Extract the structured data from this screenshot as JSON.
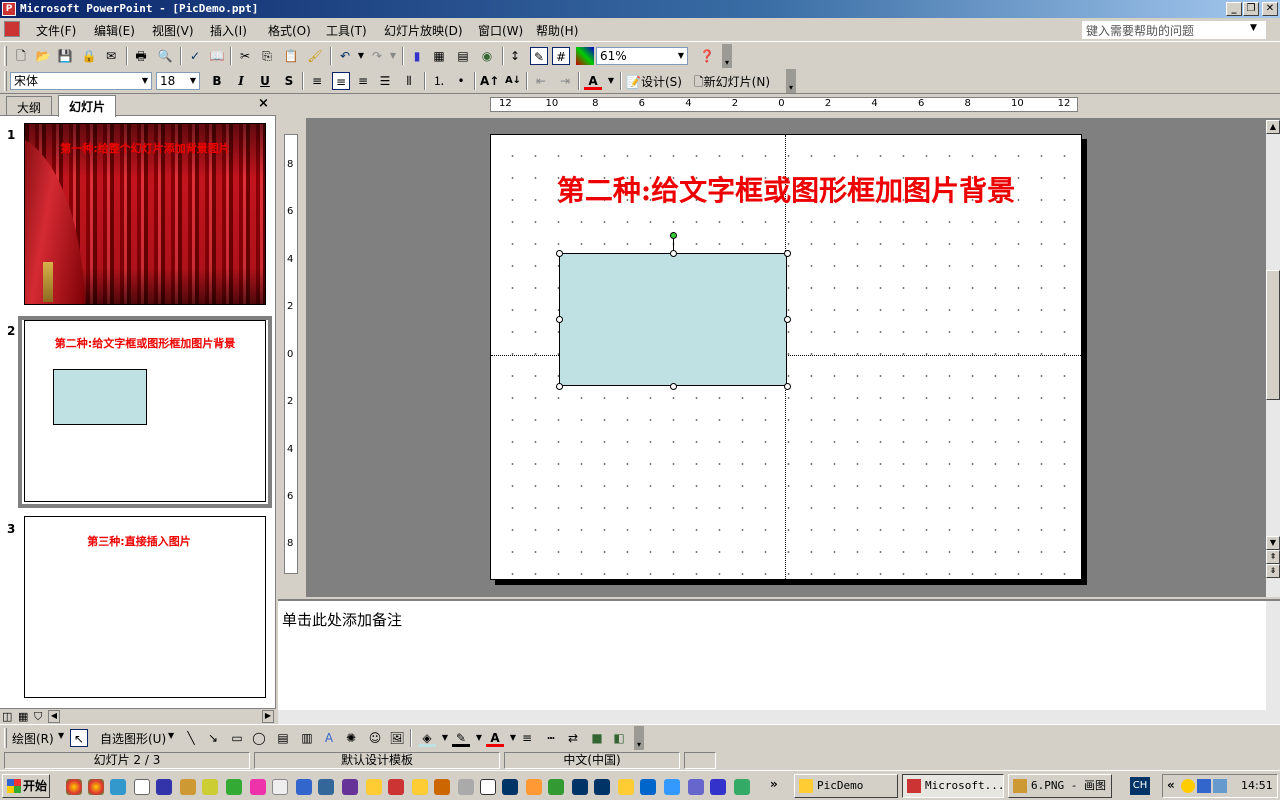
{
  "window": {
    "title": "Microsoft PowerPoint - [PicDemo.ppt]"
  },
  "menu": {
    "items": [
      "文件(F)",
      "编辑(E)",
      "视图(V)",
      "插入(I)",
      "格式(O)",
      "工具(T)",
      "幻灯片放映(D)",
      "窗口(W)",
      "帮助(H)"
    ],
    "help_placeholder": "键入需要帮助的问题"
  },
  "toolbar1": {
    "zoom": "61%"
  },
  "toolbar2": {
    "font": "宋体",
    "size": "18",
    "bold": "B",
    "italic": "I",
    "underline": "U",
    "shadow": "S",
    "font_color": "A",
    "design": "设计(S)",
    "new_slide": "新幻灯片(N)"
  },
  "left_panel": {
    "tabs": [
      "大纲",
      "幻灯片"
    ],
    "close": "×",
    "slides": [
      {
        "num": "1",
        "title": "第一种:给整个幻灯片添加背景图片"
      },
      {
        "num": "2",
        "title": "第二种:给文字框或图形框加图片背景"
      },
      {
        "num": "3",
        "title": "第三种:直接插入图片"
      }
    ]
  },
  "ruler": {
    "h_labels": [
      "12",
      "10",
      "8",
      "6",
      "4",
      "2",
      "0",
      "2",
      "4",
      "6",
      "8",
      "10",
      "12"
    ],
    "v_labels": [
      "8",
      "6",
      "4",
      "2",
      "0",
      "2",
      "4",
      "6",
      "8"
    ]
  },
  "slide": {
    "title": "第二种:给文字框或图形框加图片背景",
    "shape_fill": "#bfe1e3"
  },
  "notes": {
    "placeholder": "单击此处添加备注"
  },
  "drawbar": {
    "draw": "绘图(R)",
    "autoshapes": "自选图形(U)"
  },
  "status": {
    "slide": "幻灯片 2 / 3",
    "template": "默认设计模板",
    "language": "中文(中国)"
  },
  "taskbar": {
    "start": "开始",
    "tasks": [
      "PicDemo",
      "Microsoft...",
      "6.PNG - 画图"
    ],
    "ime": "CH",
    "time": "14:51"
  }
}
